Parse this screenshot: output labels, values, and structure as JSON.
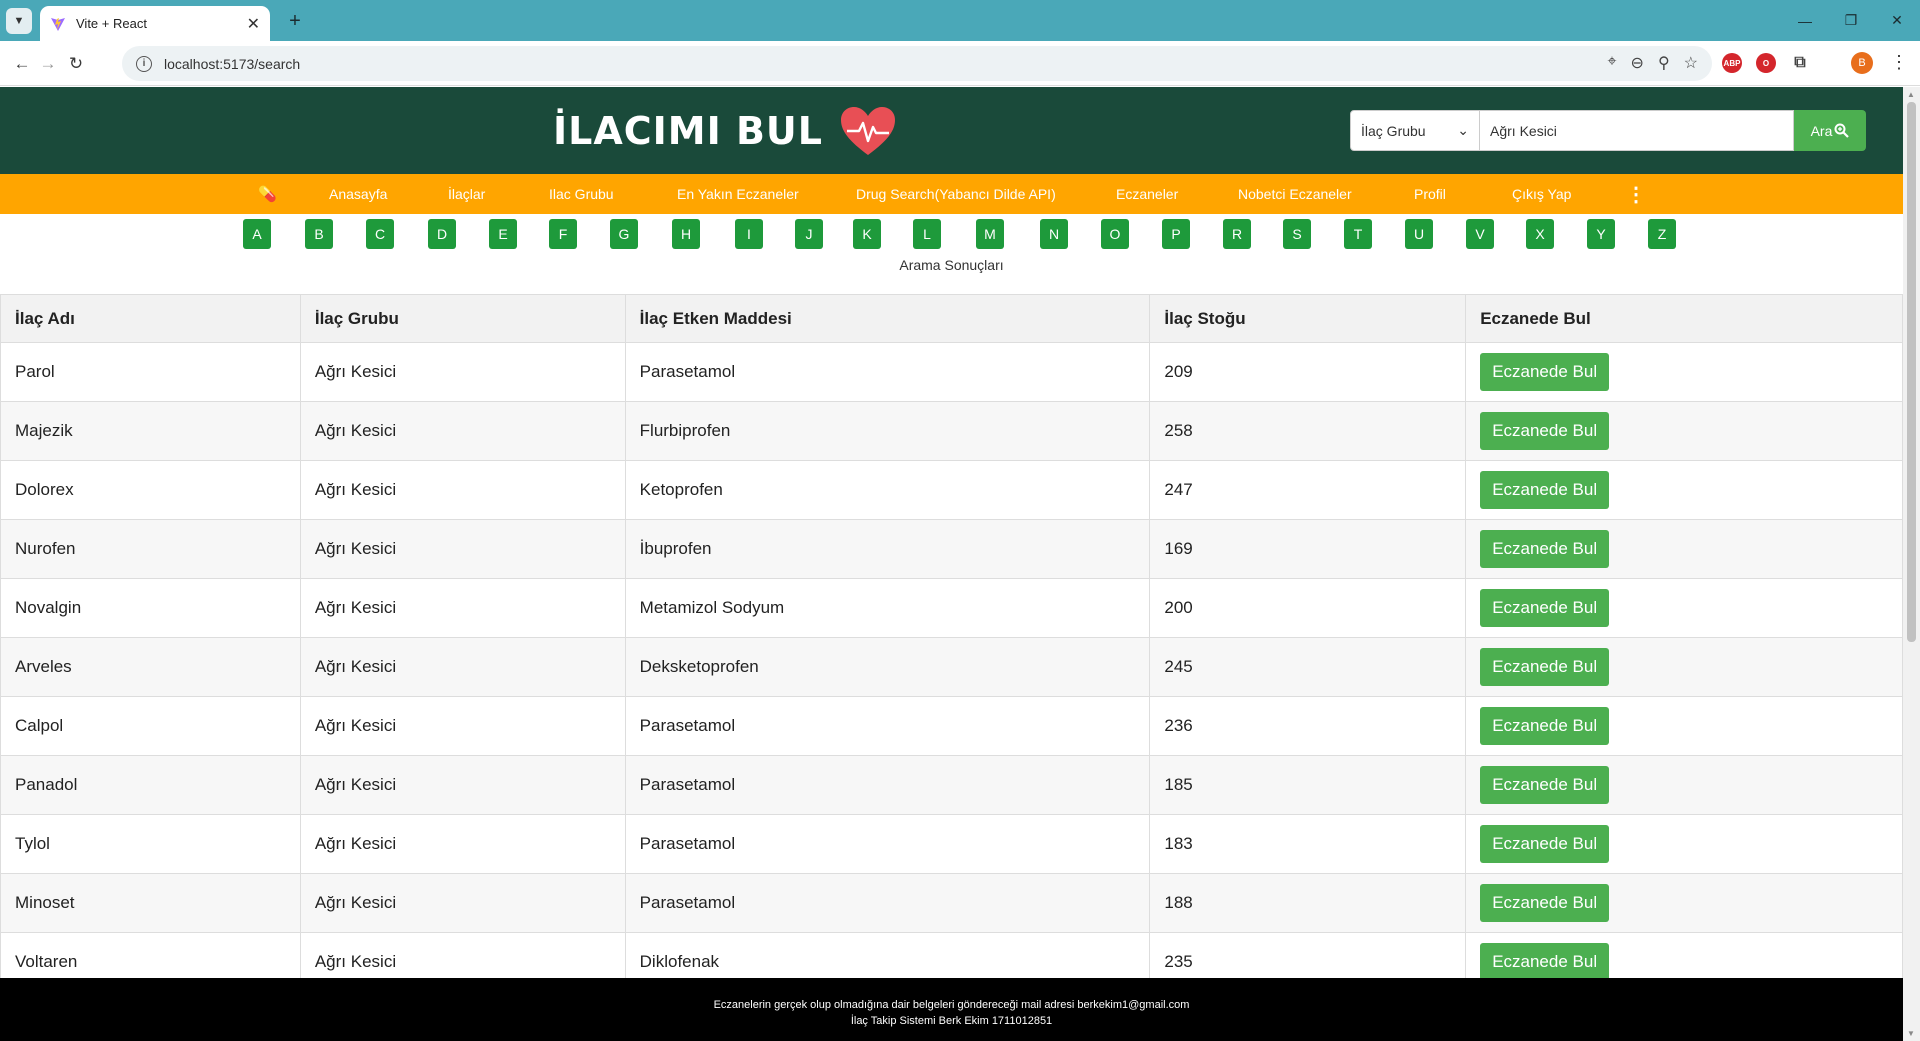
{
  "browser": {
    "tab_title": "Vite + React",
    "url": "localhost:5173/search",
    "profile_initial": "B",
    "extensions": [
      "ABP",
      "O",
      "ext"
    ]
  },
  "header": {
    "brand": "İLACIMI BUL",
    "search_select": "İlaç Grubu",
    "search_value": "Ağrı Kesici",
    "search_button": "Ara"
  },
  "nav": {
    "items": [
      "Anasayfa",
      "İlaçlar",
      "Ilac Grubu",
      "En Yakın Eczaneler",
      "Drug Search(Yabancı Dilde API)",
      "Eczaneler",
      "Nobetci Eczaneler",
      "Profil",
      "Çıkış Yap"
    ]
  },
  "alphabet": [
    "A",
    "B",
    "C",
    "D",
    "E",
    "F",
    "G",
    "H",
    "I",
    "J",
    "K",
    "L",
    "M",
    "N",
    "O",
    "P",
    "R",
    "S",
    "T",
    "U",
    "V",
    "X",
    "Y",
    "Z"
  ],
  "results_caption": "Arama Sonuçları",
  "table": {
    "headers": [
      "İlaç Adı",
      "İlaç Grubu",
      "İlaç Etken Maddesi",
      "İlaç Stoğu",
      "Eczanede Bul"
    ],
    "button_label": "Eczanede Bul",
    "rows": [
      {
        "name": "Parol",
        "group": "Ağrı Kesici",
        "ingredient": "Parasetamol",
        "stock": "209"
      },
      {
        "name": "Majezik",
        "group": "Ağrı Kesici",
        "ingredient": "Flurbiprofen",
        "stock": "258"
      },
      {
        "name": "Dolorex",
        "group": "Ağrı Kesici",
        "ingredient": "Ketoprofen",
        "stock": "247"
      },
      {
        "name": "Nurofen",
        "group": "Ağrı Kesici",
        "ingredient": "İbuprofen",
        "stock": "169"
      },
      {
        "name": "Novalgin",
        "group": "Ağrı Kesici",
        "ingredient": "Metamizol Sodyum",
        "stock": "200"
      },
      {
        "name": "Arveles",
        "group": "Ağrı Kesici",
        "ingredient": "Deksketoprofen",
        "stock": "245"
      },
      {
        "name": "Calpol",
        "group": "Ağrı Kesici",
        "ingredient": "Parasetamol",
        "stock": "236"
      },
      {
        "name": "Panadol",
        "group": "Ağrı Kesici",
        "ingredient": "Parasetamol",
        "stock": "185"
      },
      {
        "name": "Tylol",
        "group": "Ağrı Kesici",
        "ingredient": "Parasetamol",
        "stock": "183"
      },
      {
        "name": "Minoset",
        "group": "Ağrı Kesici",
        "ingredient": "Parasetamol",
        "stock": "188"
      },
      {
        "name": "Voltaren",
        "group": "Ağrı Kesici",
        "ingredient": "Diklofenak",
        "stock": "235"
      }
    ]
  },
  "footer": {
    "line1": "Eczanelerin gerçek olup olmadığına dair belgeleri göndereceği mail adresi berkekim1@gmail.com",
    "line2": "İlaç Takip Sistemi Berk Ekim 1711012851"
  },
  "colors": {
    "header_bg": "#1a4a3a",
    "nav_bg": "#ffa500",
    "accent_green": "#4caf50",
    "letter_green": "#1e9a3b",
    "heart": "#e84f55",
    "tabstrip": "#4aa8b8"
  }
}
